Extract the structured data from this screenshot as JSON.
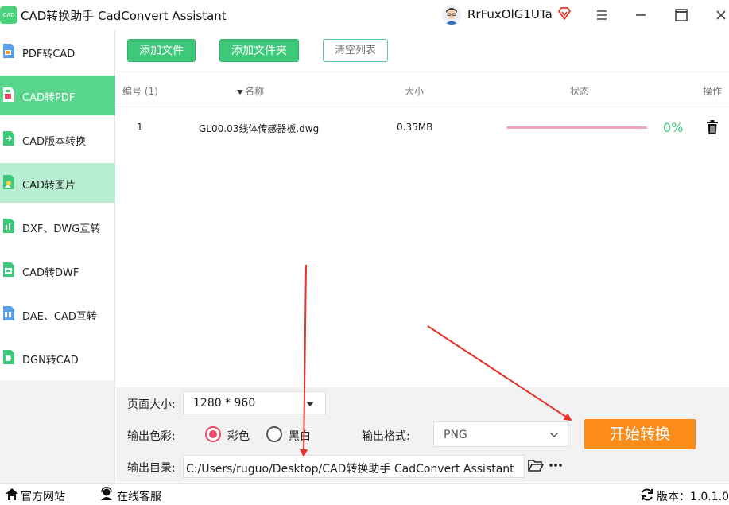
{
  "titlebar": {
    "logo_text": "CAD",
    "title": "CAD转换助手 CadConvert Assistant",
    "username": "RrFuxOlG1UTa",
    "icons": [
      "user-avatar",
      "vip-diamond-icon",
      "menu-icon",
      "minimize-icon",
      "maximize-icon",
      "close-icon"
    ]
  },
  "sidebar": {
    "items": [
      {
        "label": "PDF转CAD",
        "state": "normal"
      },
      {
        "label": "CAD转PDF",
        "state": "active"
      },
      {
        "label": "CAD版本转换",
        "state": "normal"
      },
      {
        "label": "CAD转图片",
        "state": "hover"
      },
      {
        "label": "DXF、DWG互转",
        "state": "normal"
      },
      {
        "label": "CAD转DWF",
        "state": "normal"
      },
      {
        "label": "DAE、CAD互转",
        "state": "normal"
      },
      {
        "label": "DGN转CAD",
        "state": "normal"
      }
    ]
  },
  "toolbar": {
    "add_file": "添加文件",
    "add_folder": "添加文件夹",
    "clear_list": "清空列表"
  },
  "table": {
    "headers": {
      "index": "编号 (1)",
      "name": "名称",
      "size": "大小",
      "status": "状态",
      "action": "操作"
    },
    "rows": [
      {
        "index": "1",
        "name": "GL00.03线体传感器板.dwg",
        "size": "0.35MB",
        "progress": 0,
        "progress_text": "0%"
      }
    ]
  },
  "settings": {
    "page_size_label": "页面大小:",
    "page_size_value": "1280 * 960",
    "color_label": "输出色彩:",
    "color_options": [
      {
        "label": "彩色",
        "checked": true
      },
      {
        "label": "黑白",
        "checked": false
      }
    ],
    "format_label": "输出格式:",
    "format_value": "PNG",
    "start_button": "开始转换",
    "output_dir_label": "输出目录:",
    "output_dir_value": "C:/Users/ruguo/Desktop/CAD转换助手 CadConvert Assistant"
  },
  "statusbar": {
    "website": "官方网站",
    "support": "在线客服",
    "version": "版本：1.0.1.0"
  },
  "colors": {
    "accent_green": "#3ec87a",
    "active_sidebar": "#58d68b",
    "hover_sidebar": "#b8efd2",
    "start_orange": "#fb8c1b",
    "radio_red": "#e94b6a",
    "annotation_red": "#e8322a"
  }
}
